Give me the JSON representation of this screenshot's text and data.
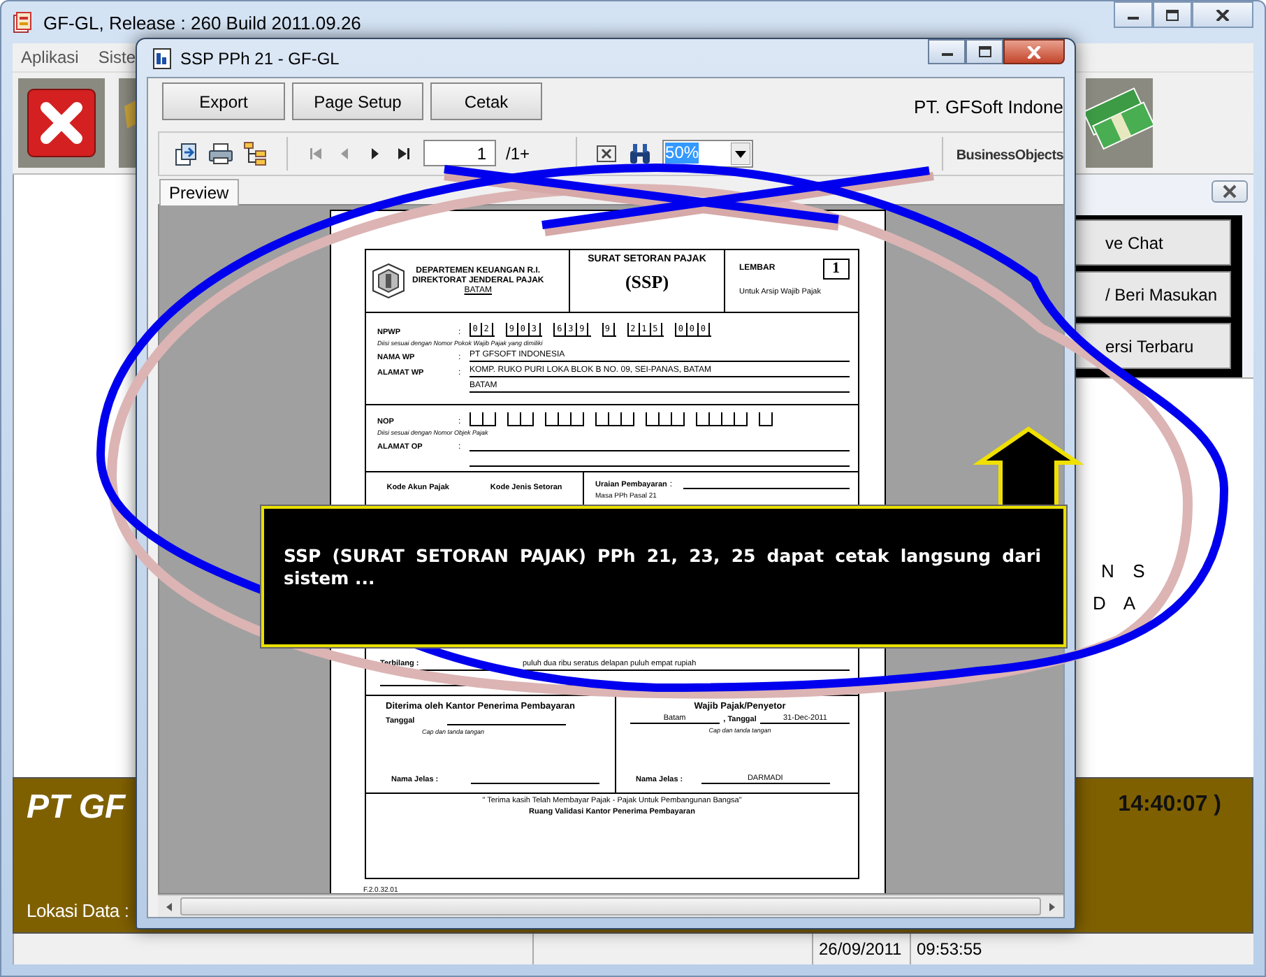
{
  "main_window": {
    "title": "GF-GL, Release : 260 Build 2011.09.26",
    "menu": [
      "Aplikasi",
      "Siste"
    ],
    "side_buttons": [
      "ve Chat",
      "/ Beri Masukan",
      "ersi Terbaru"
    ],
    "fragments": [
      "N  S",
      "D  A"
    ],
    "banner": {
      "company": "PT GF",
      "clock": "14:40:07 )",
      "location_label": "Lokasi Data :"
    },
    "status_bar": [
      "26/09/2011",
      "09:53:55"
    ]
  },
  "dialog": {
    "title": "SSP PPh 21 - GF-GL",
    "buttons": [
      "Export",
      "Page Setup",
      "Cetak"
    ],
    "company": "PT. GFSoft Indone",
    "page_field": "1",
    "page_total": "/1+",
    "zoom": "50%",
    "logo": "BusinessObjects",
    "tabs": [
      {
        "label": "Preview",
        "selected": true
      }
    ]
  },
  "document": {
    "header": {
      "department": "DEPARTEMEN KEUANGAN R.I.",
      "directorate": "DIREKTORAT JENDERAL PAJAK",
      "city": "BATAM",
      "form_title": "SURAT SETORAN PAJAK",
      "form_code": "(SSP)",
      "sheet_label": "LEMBAR",
      "sheet_number": "1",
      "sheet_note": "Untuk Arsip Wajib Pajak"
    },
    "taxpayer": {
      "npwp_label": "NPWP",
      "separator": ":",
      "npwp_groups": [
        "02",
        "903",
        "639",
        "9",
        "215",
        "000"
      ],
      "npwp_note": "Diisi sesuai dengan Nomor Pokok Wajib Pajak yang dimiliki",
      "name_label": "NAMA WP",
      "name": "PT GFSOFT INDONESIA",
      "address_label": "ALAMAT WP",
      "address_lines": [
        "KOMP. RUKO PURI LOKA BLOK B NO. 09, SEI-PANAS, BATAM",
        "BATAM"
      ]
    },
    "object": {
      "nop_label": "NOP",
      "separator": ":",
      "nop_note": "Diisi sesuai dengan Nomor Objek Pajak",
      "address_label": "ALAMAT OP"
    },
    "payment": {
      "account_code_label": "Kode Akun Pajak",
      "deposit_code_label": "Kode Jenis Setoran",
      "description_label": "Uraian Pembayaran",
      "separator": ":",
      "description_note": "Masa PPh Pasal 21",
      "amount_words_label": "Terbilang :",
      "amount_words": "puluh dua ribu seratus delapan puluh empat rupiah"
    },
    "signatures": {
      "receiver_title": "Diterima oleh Kantor Penerima Pembayaran",
      "date_label": "Tanggal",
      "stamp_note": "Cap dan tanda tangan",
      "name_label": "Nama Jelas :",
      "payer_title": "Wajib Pajak/Penyetor",
      "payer_city": "Batam",
      "payer_date_label": ", Tanggal",
      "payer_date": "31-Dec-2011",
      "payer_stamp_note": "Cap dan tanda tangan",
      "payer_name_label": "Nama Jelas :",
      "payer_name": "DARMADI"
    },
    "footer": {
      "thanks": "\" Terima kasih Telah Membayar Pajak - Pajak Untuk Pembangunan Bangsa\"",
      "validation": "Ruang Validasi Kantor Penerima Pembayaran",
      "form_number": "F.2.0.32.01"
    }
  },
  "callout": {
    "text": "SSP (SURAT SETORAN PAJAK) PPh 21, 23, 25 dapat cetak langsung dari sistem ..."
  }
}
